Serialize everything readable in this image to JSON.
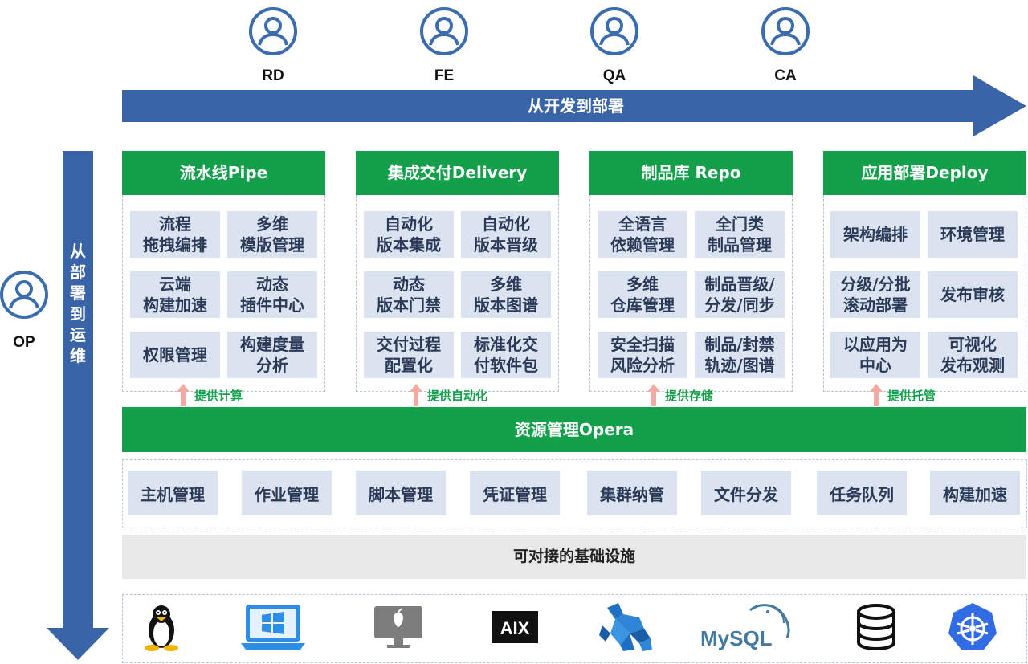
{
  "roles": [
    {
      "label": "RD"
    },
    {
      "label": "FE"
    },
    {
      "label": "QA"
    },
    {
      "label": "CA"
    }
  ],
  "op_role": {
    "label": "OP"
  },
  "top_arrow": {
    "label": "从开发到部署"
  },
  "side_arrow": {
    "label": "从部署到运维"
  },
  "panels": [
    {
      "title": "流水线Pipe",
      "cells": [
        "流程\n拖拽编排",
        "多维\n模版管理",
        "云端\n构建加速",
        "动态\n插件中心",
        "权限管理",
        "构建度量\n分析"
      ],
      "provide": "提供计算"
    },
    {
      "title": "集成交付Delivery",
      "cells": [
        "自动化\n版本集成",
        "自动化\n版本晋级",
        "动态\n版本门禁",
        "多维\n版本图谱",
        "交付过程\n配置化",
        "标准化交\n付软件包"
      ],
      "provide": "提供自动化"
    },
    {
      "title": "制品库 Repo",
      "cells": [
        "全语言\n依赖管理",
        "全门类\n制品管理",
        "多维\n仓库管理",
        "制品晋级/\n分发/同步",
        "安全扫描\n风险分析",
        "制品/封禁\n轨迹/图谱"
      ],
      "provide": "提供存储"
    },
    {
      "title": "应用部署Deploy",
      "cells": [
        "架构编排",
        "环境管理",
        "分级/分批\n滚动部署",
        "发布审核",
        "以应用为\n中心",
        "可视化\n发布观测"
      ],
      "provide": "提供托管"
    }
  ],
  "opera": {
    "label": "资源管理Opera"
  },
  "resources": [
    "主机管理",
    "作业管理",
    "脚本管理",
    "凭证管理",
    "集群纳管",
    "文件分发",
    "任务队列",
    "构建加速"
  ],
  "infra": {
    "label": "可对接的基础设施"
  },
  "tech_icons": [
    "linux-icon",
    "windows-icon",
    "macos-icon",
    "aix-icon",
    "kafka-icon",
    "mysql-icon",
    "database-icon",
    "kubernetes-icon"
  ],
  "mysql_text": "MySQL",
  "aix_text": "AIX",
  "colors": {
    "green": "#14a04a",
    "blue": "#3a64a8",
    "cell": "#dbe3f1",
    "infra": "#e8e8e8"
  }
}
